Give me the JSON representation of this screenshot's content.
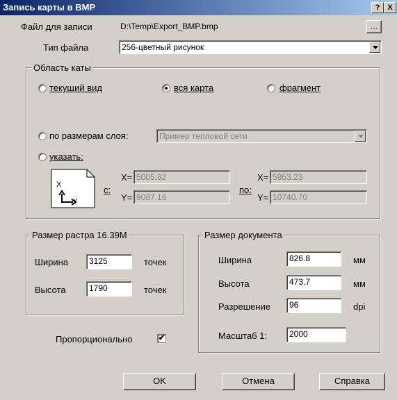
{
  "window": {
    "title": "Запись карты в BMP",
    "help_label": "?",
    "close_label": "X"
  },
  "file": {
    "label": "Файл для записи",
    "path": "D:\\Temp\\Export_BMP.bmp",
    "browse_label": "..."
  },
  "file_type": {
    "label": "Тип файла",
    "value": "256-цветный рисунок"
  },
  "area": {
    "legend": "Область каты",
    "opt_current": "текущий вид",
    "opt_whole": "вся карта",
    "opt_fragment": "фрагмент",
    "opt_by_layer": "по размерам слоя:",
    "layer_value": "Пример тепловой сети",
    "opt_specify": "указать:",
    "from_label": "с:",
    "to_label": "по:",
    "x_label": "X=",
    "y_label": "Y=",
    "x_from": "5005.82",
    "y_from": "9087.16",
    "x_to": "5953.23",
    "y_to": "10740.70",
    "axis_x": "X",
    "axis_y": "Y",
    "selected": "whole"
  },
  "raster": {
    "legend": "Размер растра 16.39М",
    "width_label": "Ширина",
    "width_value": "3125",
    "height_label": "Высота",
    "height_value": "1790",
    "unit": "точек"
  },
  "document": {
    "legend": "Размер документа",
    "width_label": "Ширина",
    "width_value": "826.8",
    "height_label": "Высота",
    "height_value": "473.7",
    "resolution_label": "Разрешение",
    "resolution_value": "96",
    "scale_label": "Масштаб 1:",
    "scale_value": "2000",
    "mm_unit": "мм",
    "dpi_unit": "dpi"
  },
  "proportional": {
    "label": "Пропорционально",
    "checked": true,
    "check_mark": "✔"
  },
  "buttons": {
    "ok": "OK",
    "cancel": "Отмена",
    "help": "Справка"
  }
}
